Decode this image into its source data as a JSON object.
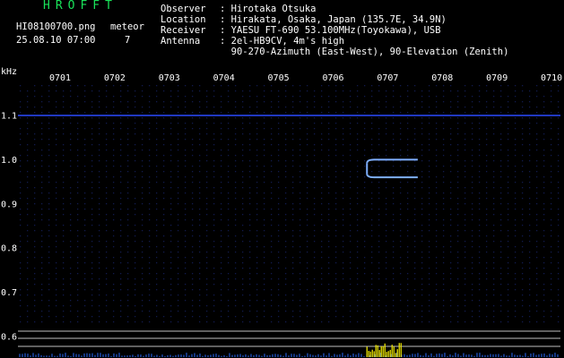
{
  "header": {
    "app_title": "HROFFT",
    "filename": "HI08100700.png",
    "datetime": "25.08.10 07:00",
    "meteor_label": "meteor",
    "meteor_count": "7",
    "meta": [
      {
        "key": "Observer",
        "value": ": Hirotaka Otsuka"
      },
      {
        "key": "Location",
        "value": ": Hirakata, Osaka, Japan (135.7E, 34.9N)"
      },
      {
        "key": "Receiver",
        "value": ": YAESU FT-690 53.100MHz(Toyokawa), USB"
      },
      {
        "key": "Antenna",
        "value": ": 2el-HB9CV, 4m's high"
      },
      {
        "key": "",
        "value": "  90-270-Azimuth (East-West), 90-Elevation (Zenith)"
      }
    ]
  },
  "chart_data": {
    "type": "heatmap",
    "ylabel": "kHz",
    "x_ticks": [
      "0701",
      "0702",
      "0703",
      "0704",
      "0705",
      "0706",
      "0707",
      "0708",
      "0709",
      "0710"
    ],
    "y_ticks": [
      "1.1",
      "1.0",
      "0.9",
      "0.8",
      "0.7",
      "0.6"
    ],
    "y_tick_values": [
      1.1,
      1.0,
      0.9,
      0.8,
      0.7,
      0.6
    ],
    "x_range_minutes": [
      0,
      10
    ],
    "y_range_khz": [
      0.585,
      1.2
    ],
    "carrier_line_khz": 1.1,
    "meteor_echo": {
      "t_start_minutes": 6.62,
      "t_end_minutes": 7.55,
      "f_upper_khz": 1.0,
      "f_lower_khz": 0.96
    },
    "colors": {
      "background": "#000000",
      "grid_dots": "#1f2f8a",
      "carrier": "#2b4bff",
      "echo": "#7fb0ff",
      "text": "#ffffff",
      "title": "#19e35a"
    }
  }
}
